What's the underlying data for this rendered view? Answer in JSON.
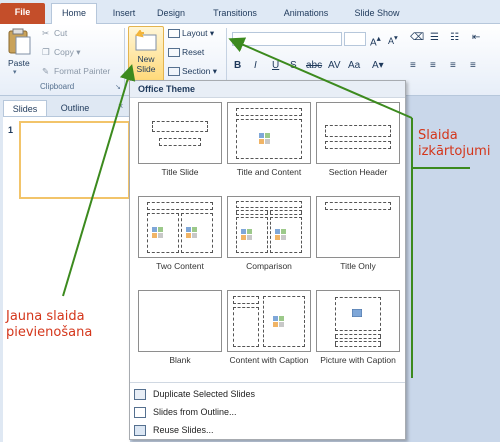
{
  "tabs": [
    "File",
    "Home",
    "Insert",
    "Design",
    "Transitions",
    "Animations",
    "Slide Show"
  ],
  "clipboard": {
    "paste_label": "Paste",
    "cut_label": "Cut",
    "copy_label": "Copy",
    "format_painter_label": "Format Painter",
    "group_label": "Clipboard"
  },
  "slides_group": {
    "new_slide_label_1": "New",
    "new_slide_label_2": "Slide",
    "layout_label": "Layout",
    "reset_label": "Reset",
    "section_label": "Section"
  },
  "pane": {
    "slides_tab": "Slides",
    "outline_tab": "Outline",
    "close_glyph": "×",
    "slide_number": "1"
  },
  "gallery": {
    "title": "Office Theme",
    "layouts": [
      "Title Slide",
      "Title and Content",
      "Section Header",
      "Two Content",
      "Comparison",
      "Title Only",
      "Blank",
      "Content with Caption",
      "Picture with Caption"
    ],
    "menu": [
      "Duplicate Selected Slides",
      "Slides from Outline...",
      "Reuse Slides..."
    ]
  },
  "annotations": {
    "layout_note_1": "Slaida",
    "layout_note_2": "izkārtojumi",
    "new_slide_note_1": "Jauna slaida",
    "new_slide_note_2": "pievienošana"
  },
  "colors": {
    "file_tab": "#c44e2a",
    "annotation_text": "#d4361b",
    "annotation_arrow": "#3c8a1e"
  }
}
